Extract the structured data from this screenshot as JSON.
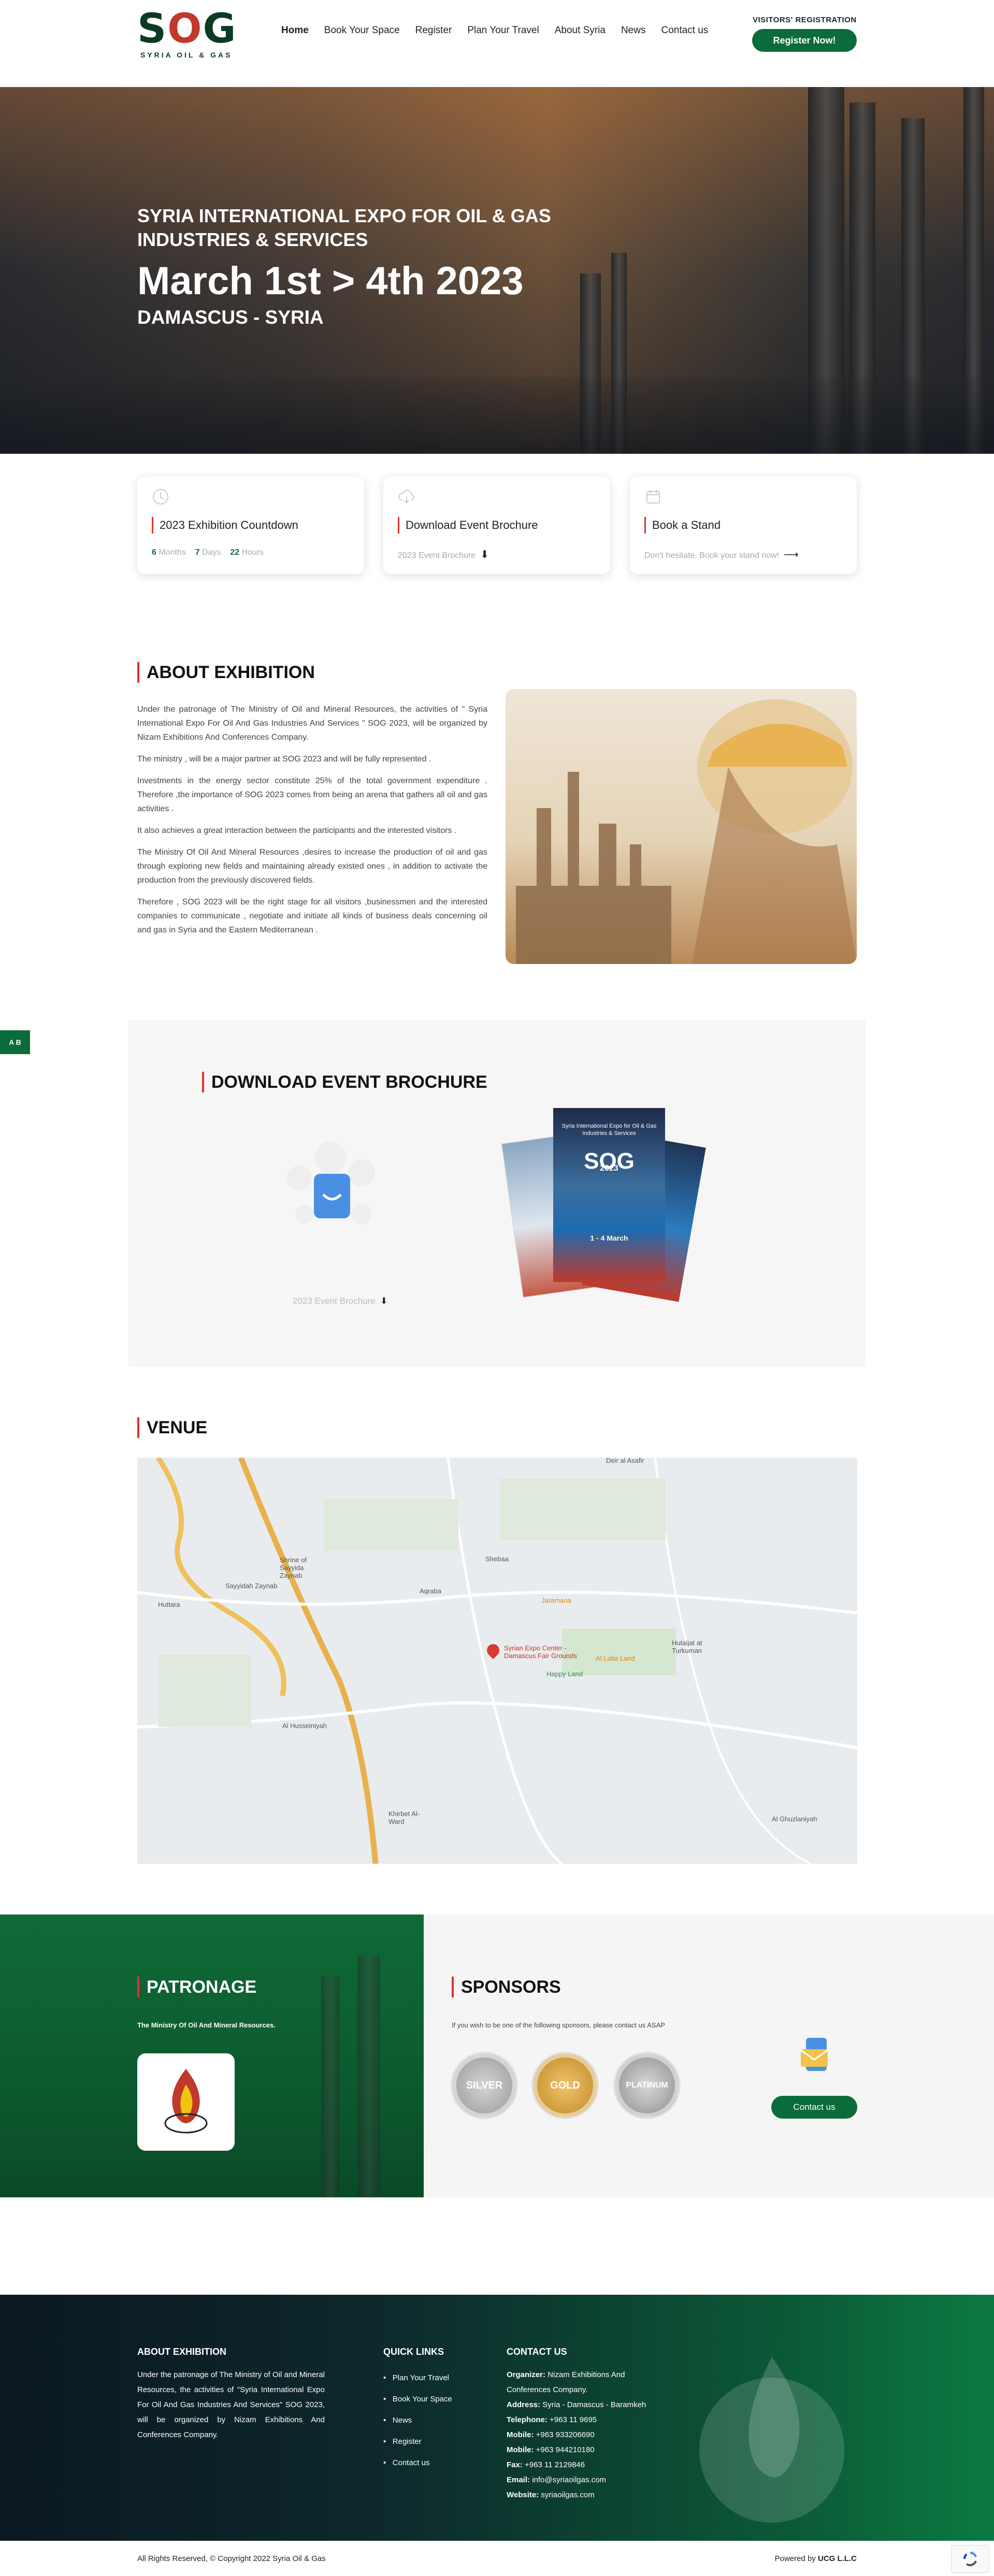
{
  "header": {
    "logo_mark": "S",
    "logo_o": "O",
    "logo_g": "G",
    "logo_tagline": "SYRIA OIL & GAS",
    "nav": [
      "Home",
      "Book Your Space",
      "Register",
      "Plan Your Travel",
      "About Syria",
      "News",
      "Contact us"
    ],
    "visitors_label": "VISITORS' REGISTRATION",
    "register_button": "Register Now!"
  },
  "hero": {
    "title_line1": "SYRIA INTERNATIONAL EXPO FOR OIL & GAS",
    "title_line2": "INDUSTRIES & SERVICES",
    "dates": "March 1st > 4th 2023",
    "location": "DAMASCUS - SYRIA"
  },
  "cards": [
    {
      "title": "2023 Exhibition Countdown",
      "months": "6",
      "months_label": "Months",
      "days": "7",
      "days_label": "Days",
      "hours": "22",
      "hours_label": "Hours"
    },
    {
      "title": "Download Event Brochure",
      "sub": "2023 Event Brochure"
    },
    {
      "title": "Book a Stand",
      "sub": "Don't hesitate, Book your stand now!"
    }
  ],
  "about": {
    "heading": "ABOUT EXHIBITION",
    "paragraphs": [
      "Under the patronage of The Ministry of Oil and Mineral Resources, the activities of \" Syria International Expo For Oil And Gas  Industries And Services \" SOG 2023, will be organized by Nizam Exhibitions And Conferences Company.",
      "The ministry , will be a major partner at SOG 2023 and will be fully represented .",
      "Investments in the energy sector constitute 25% of the total government expenditure . Therefore ,the importance of SOG 2023 comes from being an arena that gathers all oil and gas activities .",
      "It also achieves a great interaction between the participants and the interested visitors .",
      "The Ministry Of Oil And Mineral Resources ,desires to increase the production of oil and gas through exploring new fields and maintaining already existed ones , in addition to activate the production from the previously discovered fields.",
      "Therefore , SOG 2023 will be the right stage for all visitors ,businessmen and the interested companies to communicate , negotiate and initiate all kinds of business deals concerning oil and gas in Syria and the Eastern Mediterranean ."
    ]
  },
  "side_badge": "A B",
  "brochure": {
    "heading": "DOWNLOAD EVENT BROCHURE",
    "link": "2023 Event Brochure",
    "cover_title": "Syria International Expo for Oil & Gas Industries & Services",
    "cover_logo": "SOG",
    "cover_year": "2023",
    "cover_date": "1 - 4 March"
  },
  "venue": {
    "heading": "VENUE",
    "map_labels": [
      "Deir al Asafir",
      "Shrine of Sayyida Zaynab",
      "Sayyidah Zaynab",
      "Huttara",
      "Shebaa",
      "Aqraba",
      "Jaramana",
      "Syrian Expo Center - Damascus Fair Grounds",
      "Happy Land",
      "Al Lafia Land",
      "Hutaijat at Turkuman",
      "Al Husseiniyah",
      "Khirbet Al-Ward",
      "Al Ghuzlaniyah"
    ]
  },
  "patronage": {
    "heading": "PATRONAGE",
    "text": "The Ministry Of Oil And Mineral Resources."
  },
  "sponsors": {
    "heading": "SPONSORS",
    "text": "If you wish to be one of the following sponsors, please contact us ASAP",
    "tiers": [
      "SILVER",
      "GOLD",
      "PLATINUM"
    ],
    "contact_button": "Contact us"
  },
  "footer": {
    "about_heading": "ABOUT EXHIBITION",
    "about_text": "Under the patronage of The Ministry of Oil and Mineral Resources, the activities of \"Syria International Expo For Oil And Gas Industries And Services\" SOG 2023, will be organized by Nizam Exhibitions And Conferences Company.",
    "links_heading": "QUICK LINKS",
    "links": [
      "Plan Your Travel",
      "Book Your Space",
      "News",
      "Register",
      "Contact us"
    ],
    "contact_heading": "CONTACT US",
    "organizer_label": "Organizer:",
    "organizer": "Nizam Exhibitions And Conferences Company.",
    "address_label": "Address:",
    "address": "Syria - Damascus - Baramkeh",
    "telephone_label": "Telephone:",
    "telephone": "+963 11 9695",
    "mobile1_label": "Mobile:",
    "mobile1": "+963 933206690",
    "mobile2_label": "Mobile:",
    "mobile2": "+963 944210180",
    "fax_label": "Fax:",
    "fax": "+963 11 2129846",
    "email_label": "Email:",
    "email": "info@syriaoilgas.com",
    "website_label": "Website:",
    "website": "syriaoilgas.com",
    "copyright": "All Rights Reserved, © Copyright 2022 Syria Oil & Gas",
    "powered_label": "Powered by",
    "powered": "UCG L.L.C"
  },
  "colors": {
    "brand_green": "#0b6b3a",
    "accent_red": "#d33333"
  }
}
